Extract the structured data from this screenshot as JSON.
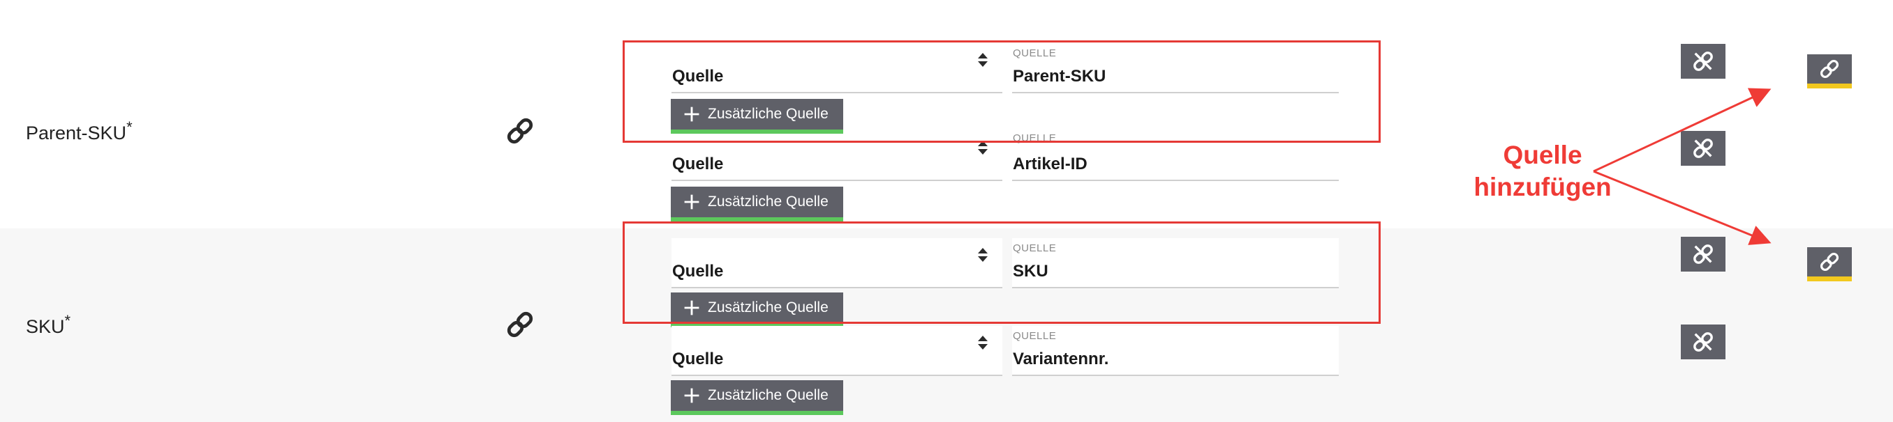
{
  "fields": [
    {
      "label": "Parent-SKU",
      "required_mark": "*",
      "mappings": [
        {
          "select_value": "Quelle",
          "source_label": "QUELLE",
          "source_value": "Parent-SKU",
          "add_label": "Zusätzliche Quelle"
        },
        {
          "select_value": "Quelle",
          "source_label": "QUELLE",
          "source_value": "Artikel-ID",
          "add_label": "Zusätzliche Quelle"
        }
      ]
    },
    {
      "label": "SKU",
      "required_mark": "*",
      "mappings": [
        {
          "select_value": "Quelle",
          "source_label": "QUELLE",
          "source_value": "SKU",
          "add_label": "Zusätzliche Quelle"
        },
        {
          "select_value": "Quelle",
          "source_label": "QUELLE",
          "source_value": "Variantennr.",
          "add_label": "Zusätzliche Quelle"
        }
      ]
    }
  ],
  "annotation": {
    "line1": "Quelle",
    "line2": "hinzufügen",
    "color": "#ef3b36"
  },
  "colors": {
    "button_bg": "#5f6068",
    "button_green_accent": "#5cc85c",
    "button_yellow_accent": "#f2c81e",
    "highlight_red": "#e53935",
    "row_alt_bg": "#f7f7f7"
  },
  "icons": {
    "field_link": "link-icon",
    "remove_mapping": "unlink-icon",
    "add_source_link": "link-icon",
    "select_arrows": "sort-arrows-icon",
    "add": "plus-icon"
  }
}
